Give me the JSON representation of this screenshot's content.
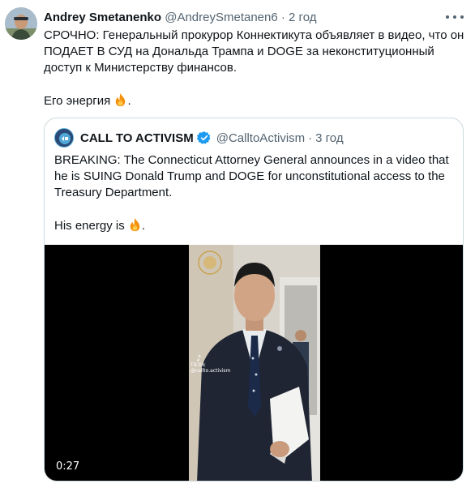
{
  "tweet": {
    "author_name": "Andrey Smetanenko",
    "author_handle": "@AndreySmetanen6",
    "separator": "·",
    "time": "2 год",
    "text_line": "СРОЧНО: Генеральный прокурор Коннектикута объявляет в видео, что он ПОДАЕТ В СУД на Дональда Трампа и DOGE за неконституционный доступ к Министерству финансов.",
    "text_line2": "Его энергия",
    "text_line2_end": "."
  },
  "quoted_tweet": {
    "author_name": "CALL TO ACTIVISM",
    "author_handle": "@CalltoActivism",
    "separator": "·",
    "time": "3 год",
    "text_line": "BREAKING: The Connecticut Attorney General announces in a video that he is SUING Donald Trump and DOGE for unconstitutional access to the Treasury Department.",
    "text_line2": "His energy is",
    "text_line2_end": "."
  },
  "video": {
    "duration": "0:27",
    "watermark_brand": "TikTok",
    "watermark_handle": "@callto.activism"
  },
  "colors": {
    "text": "#0f1419",
    "secondary": "#536471",
    "border": "#cfd9de",
    "verified": "#1d9bf0",
    "video_bg": "#000000"
  },
  "icons": {
    "more": "more-horizontal-icon",
    "verified": "verified-badge-icon",
    "fire": "fire-emoji-icon"
  }
}
